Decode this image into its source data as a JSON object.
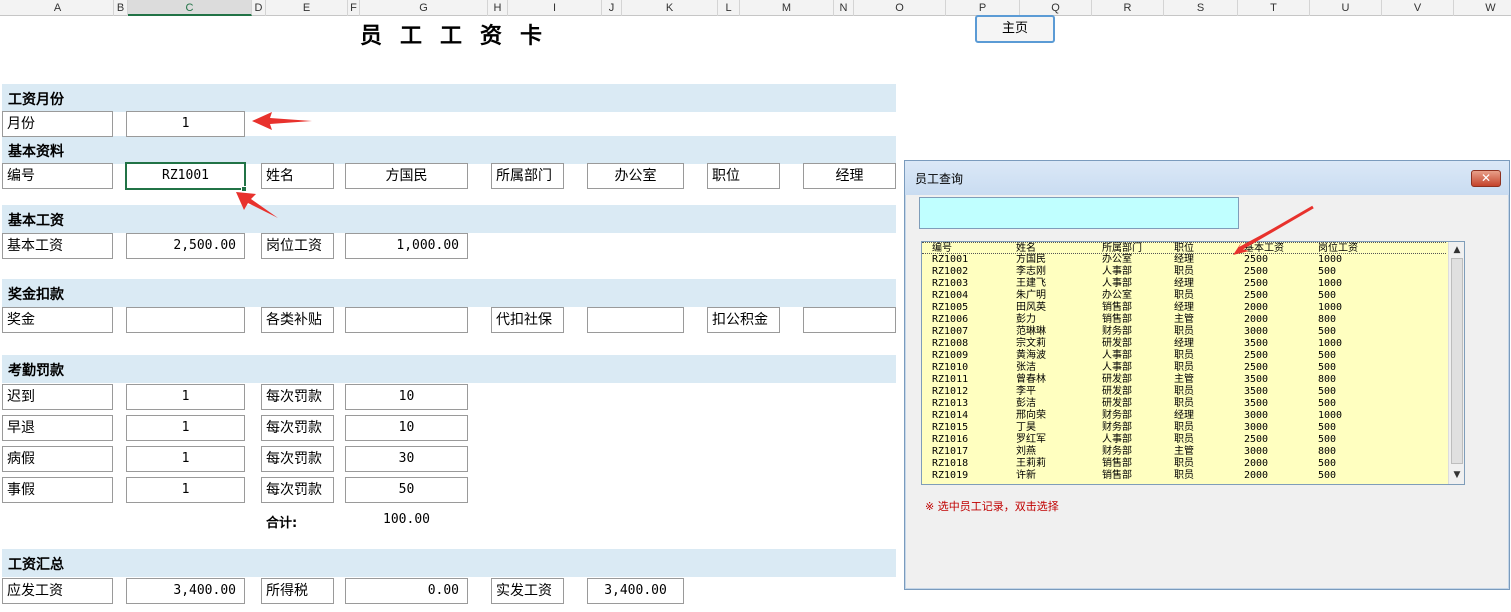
{
  "columns": [
    "A",
    "B",
    "C",
    "D",
    "E",
    "F",
    "G",
    "H",
    "I",
    "J",
    "K",
    "L",
    "M",
    "N",
    "O",
    "P",
    "Q",
    "R",
    "S",
    "T",
    "U",
    "V",
    "W"
  ],
  "selected_column": "C",
  "sheet": {
    "title": "员工工资卡",
    "home_button": "主页",
    "sections": {
      "month": "工资月份",
      "basic_info": "基本资料",
      "basic_salary": "基本工资",
      "bonus_deduction": "奖金扣款",
      "attendance": "考勤罚款",
      "summary": "工资汇总"
    },
    "month_label": "月份",
    "month_value": "1",
    "id_label": "编号",
    "id_value": "RZ1001",
    "name_label": "姓名",
    "name_value": "方国民",
    "dept_label": "所属部门",
    "dept_value": "办公室",
    "position_label": "职位",
    "position_value": "经理",
    "base_label": "基本工资",
    "base_value": "2,500.00",
    "post_label": "岗位工资",
    "post_value": "1,000.00",
    "bonus_label": "奖金",
    "bonus_value": "",
    "allowance_label": "各类补贴",
    "allowance_value": "",
    "social_label": "代扣社保",
    "social_value": "",
    "fund_label": "扣公积金",
    "fund_value": "",
    "attendance_rows": [
      {
        "label": "迟到",
        "count": "1",
        "fine_label": "每次罚款",
        "fine": "10"
      },
      {
        "label": "早退",
        "count": "1",
        "fine_label": "每次罚款",
        "fine": "10"
      },
      {
        "label": "病假",
        "count": "1",
        "fine_label": "每次罚款",
        "fine": "30"
      },
      {
        "label": "事假",
        "count": "1",
        "fine_label": "每次罚款",
        "fine": "50"
      }
    ],
    "total_label": "合计:",
    "total_value": "100.00",
    "gross_label": "应发工资",
    "gross_value": "3,400.00",
    "tax_label": "所得税",
    "tax_value": "0.00",
    "net_label": "实发工资",
    "net_value": "3,400.00"
  },
  "dialog": {
    "title": "员工查询",
    "close": "✕",
    "search_value": "",
    "headers": [
      "编号",
      "姓名",
      "所属部门",
      "职位",
      "基本工资",
      "岗位工资"
    ],
    "rows": [
      [
        "RZ1001",
        "方国民",
        "办公室",
        "经理",
        "2500",
        "1000"
      ],
      [
        "RZ1002",
        "李志刚",
        "人事部",
        "职员",
        "2500",
        "500"
      ],
      [
        "RZ1003",
        "王建飞",
        "人事部",
        "经理",
        "2500",
        "1000"
      ],
      [
        "RZ1004",
        "朱广明",
        "办公室",
        "职员",
        "2500",
        "500"
      ],
      [
        "RZ1005",
        "田风英",
        "销售部",
        "经理",
        "2000",
        "1000"
      ],
      [
        "RZ1006",
        "彭力",
        "销售部",
        "主管",
        "2000",
        "800"
      ],
      [
        "RZ1007",
        "范琳琳",
        "财务部",
        "职员",
        "3000",
        "500"
      ],
      [
        "RZ1008",
        "宗文莉",
        "研发部",
        "经理",
        "3500",
        "1000"
      ],
      [
        "RZ1009",
        "黄海波",
        "人事部",
        "职员",
        "2500",
        "500"
      ],
      [
        "RZ1010",
        "张洁",
        "人事部",
        "职员",
        "2500",
        "500"
      ],
      [
        "RZ1011",
        "曾春林",
        "研发部",
        "主管",
        "3500",
        "800"
      ],
      [
        "RZ1012",
        "李平",
        "研发部",
        "职员",
        "3500",
        "500"
      ],
      [
        "RZ1013",
        "彭洁",
        "研发部",
        "职员",
        "3500",
        "500"
      ],
      [
        "RZ1014",
        "邢向荣",
        "财务部",
        "经理",
        "3000",
        "1000"
      ],
      [
        "RZ1015",
        "丁昊",
        "财务部",
        "职员",
        "3000",
        "500"
      ],
      [
        "RZ1016",
        "罗红军",
        "人事部",
        "职员",
        "2500",
        "500"
      ],
      [
        "RZ1017",
        "刘燕",
        "财务部",
        "主管",
        "3000",
        "800"
      ],
      [
        "RZ1018",
        "王莉莉",
        "销售部",
        "职员",
        "2000",
        "500"
      ],
      [
        "RZ1019",
        "许新",
        "销售部",
        "职员",
        "2000",
        "500"
      ]
    ],
    "hint": "※   选中员工记录，双击选择",
    "scroll_up": "▲",
    "scroll_down": "▼"
  },
  "colors": {
    "accent": "#217346",
    "band": "#daeaf4",
    "arrow": "#e8322d",
    "list_bg": "#ffffc0",
    "search_bg": "#c0ffff"
  }
}
